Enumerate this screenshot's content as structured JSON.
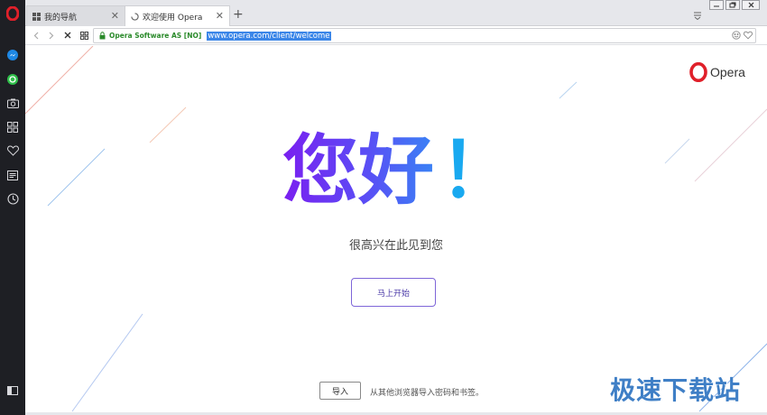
{
  "tabs": [
    {
      "title": "我的导航",
      "icon": "speed-dial-grid-icon",
      "active": false
    },
    {
      "title": "欢迎使用 Opera",
      "icon": "loading-spinner-icon",
      "active": true
    }
  ],
  "address_bar": {
    "certificate": "Opera Software AS [NO]",
    "url": "www.opera.com/client/welcome"
  },
  "sidebar": {
    "items": [
      "opera-logo-icon",
      "messenger-icon",
      "whatsapp-icon",
      "camera-icon",
      "apps-grid-icon",
      "heart-icon",
      "news-icon",
      "clock-icon",
      "sidebar-toggle-icon"
    ]
  },
  "welcome": {
    "logo_text": "Opera",
    "hello": "您好",
    "exclamation": "！",
    "subtitle": "很高兴在此见到您",
    "start_button": "马上开始",
    "import_button": "导入",
    "import_text": "从其他浏览器导入密码和书签。"
  },
  "watermark": "极速下载站",
  "colors": {
    "sidebar_bg": "#1e1f24",
    "opera_red": "#e0202a",
    "hello_gradient_start": "#7a1ff0",
    "hello_gradient_end": "#3a82f5",
    "exclamation": "#19a9f0",
    "url_highlight": "#3b86e8",
    "cert_green": "#2a8a2a"
  }
}
